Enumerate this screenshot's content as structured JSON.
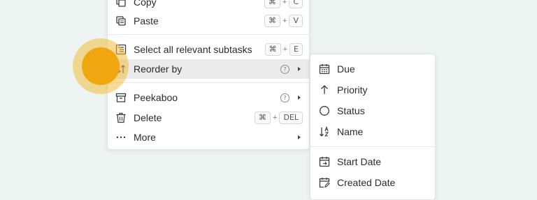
{
  "main_menu": {
    "copy": {
      "label": "Copy",
      "keys": [
        "⌘",
        "C"
      ]
    },
    "paste": {
      "label": "Paste",
      "keys": [
        "⌘",
        "V"
      ]
    },
    "select_subtasks": {
      "label": "Select all relevant subtasks",
      "keys": [
        "⌘",
        "E"
      ]
    },
    "reorder_by": {
      "label": "Reorder by"
    },
    "peekaboo": {
      "label": "Peekaboo"
    },
    "delete": {
      "label": "Delete",
      "keys": [
        "⌘",
        "DEL"
      ]
    },
    "more": {
      "label": "More"
    },
    "plus": "+",
    "help_glyph": "?"
  },
  "sub_menu": {
    "due": "Due",
    "priority": "Priority",
    "status": "Status",
    "name": "Name",
    "start_date": "Start Date",
    "created_date": "Created Date"
  },
  "colors": {
    "background": "#eef4f1",
    "highlight": "#ebebeb",
    "cursor": "#efa60f"
  }
}
